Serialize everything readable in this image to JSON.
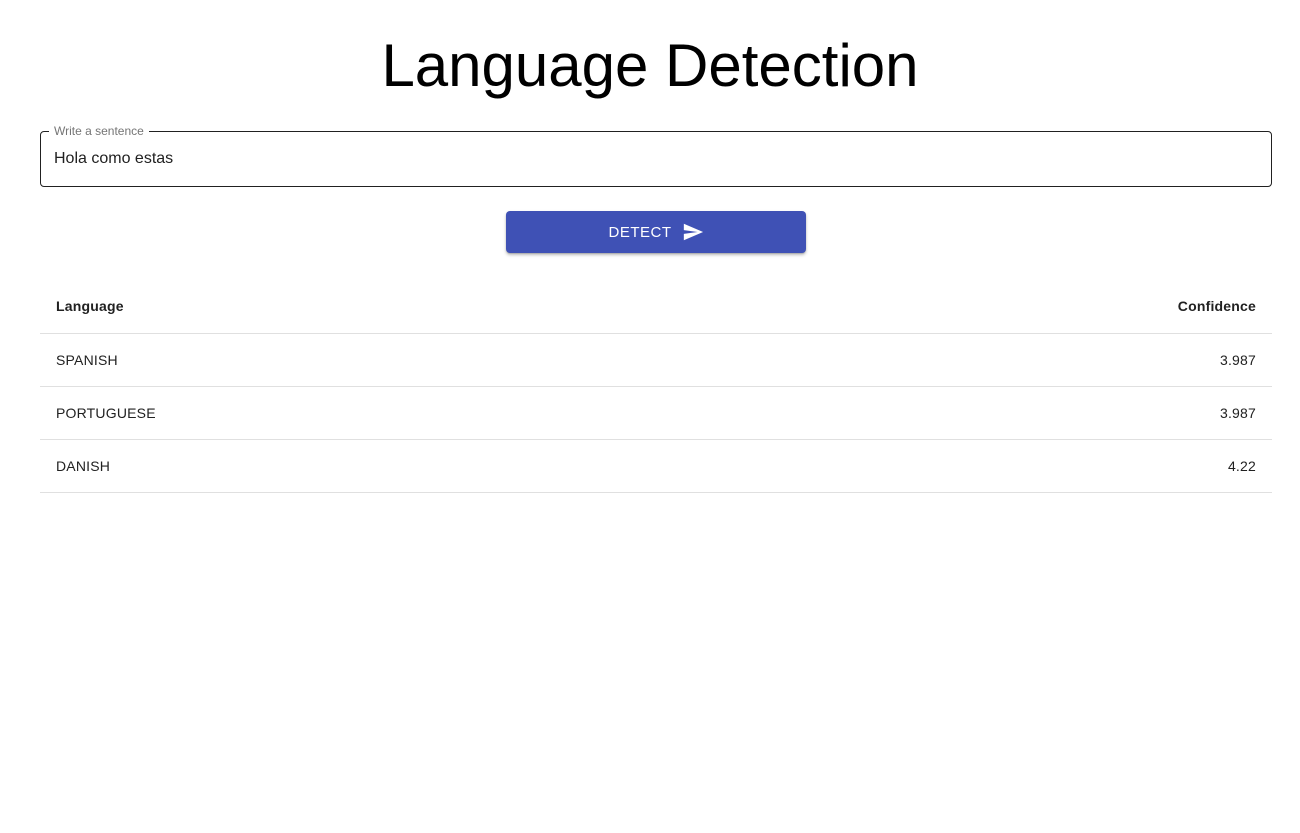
{
  "page": {
    "title": "Language Detection"
  },
  "form": {
    "label": "Write a sentence",
    "value": "Hola como estas",
    "button_label": "DETECT",
    "button_icon": "send-icon",
    "accent_color": "#3f51b5"
  },
  "results": {
    "columns": [
      "Language",
      "Confidence"
    ],
    "rows": [
      {
        "language": "SPANISH",
        "confidence": "3.987"
      },
      {
        "language": "PORTUGUESE",
        "confidence": "3.987"
      },
      {
        "language": "DANISH",
        "confidence": "4.22"
      }
    ]
  }
}
